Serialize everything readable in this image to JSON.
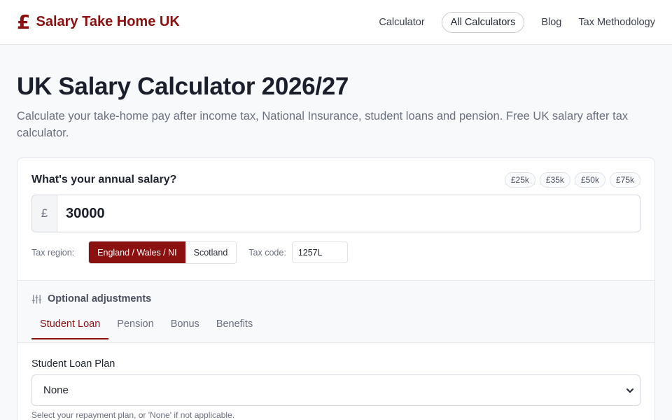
{
  "brand": {
    "icon_glyph": "£",
    "icon": "pound-icon",
    "name": "Salary Take Home UK",
    "color": "#8b1010"
  },
  "nav": {
    "calculator": "Calculator",
    "all_calculators": "All Calculators",
    "blog": "Blog",
    "tax_methodology": "Tax Methodology"
  },
  "hero": {
    "title": "UK Salary Calculator 2026/27",
    "subtitle": "Calculate your take-home pay after income tax, National Insurance, student loans and pension. Free UK salary after tax calculator."
  },
  "salary": {
    "label": "What's your annual salary?",
    "presets": [
      "£25k",
      "£35k",
      "£50k",
      "£75k"
    ],
    "currency": "£",
    "value": "30000"
  },
  "tax": {
    "region_label": "Tax region:",
    "regions": [
      "England / Wales / NI",
      "Scotland"
    ],
    "selected_region": "England / Wales / NI",
    "code_label": "Tax code:",
    "code_value": "1257L"
  },
  "adjustments": {
    "icon": "sliders-icon",
    "label": "Optional adjustments",
    "tabs": [
      "Student Loan",
      "Pension",
      "Bonus",
      "Benefits"
    ],
    "active_tab": "Student Loan"
  },
  "student_loan": {
    "label": "Student Loan Plan",
    "selected": "None",
    "help": "Select your repayment plan, or 'None' if not applicable."
  }
}
